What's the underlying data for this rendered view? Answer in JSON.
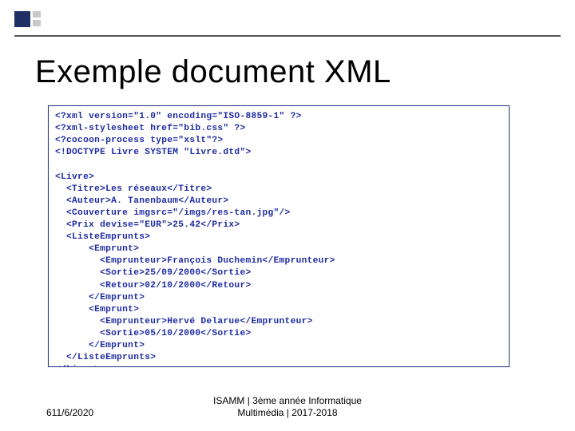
{
  "deco": {
    "present": true
  },
  "title": "Exemple document XML",
  "code_lines": [
    "<?xml version=\"1.0\" encoding=\"ISO-8859-1\" ?>",
    "<?xml-stylesheet href=\"bib.css\" ?>",
    "<?cocoon-process type=\"xslt\"?>",
    "<!DOCTYPE Livre SYSTEM \"Livre.dtd\">",
    "",
    "<Livre>",
    "  <Titre>Les réseaux</Titre>",
    "  <Auteur>A. Tanenbaum</Auteur>",
    "  <Couverture imgsrc=\"/imgs/res-tan.jpg\"/>",
    "  <Prix devise=\"EUR\">25.42</Prix>",
    "  <ListeEmprunts>",
    "      <Emprunt>",
    "        <Emprunteur>François Duchemin</Emprunteur>",
    "        <Sortie>25/09/2000</Sortie>",
    "        <Retour>02/10/2000</Retour>",
    "      </Emprunt>",
    "      <Emprunt>",
    "        <Emprunteur>Hervé Delarue</Emprunteur>",
    "        <Sortie>05/10/2000</Sortie>",
    "      </Emprunt>",
    "  </ListeEmprunts>",
    "</Livre>"
  ],
  "footer": {
    "page_number": "61",
    "date": "1/6/2020",
    "center_line1": "ISAMM | 3ème année Informatique",
    "center_line2": "Multimédia | 2017-2018"
  }
}
